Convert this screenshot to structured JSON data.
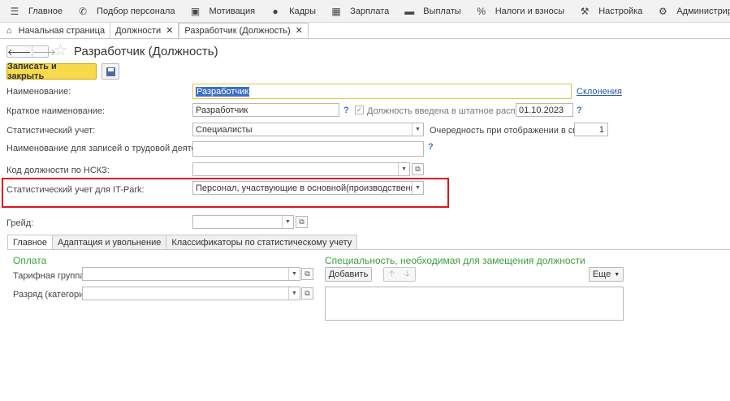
{
  "menu": [
    {
      "label": "Главное",
      "icon": "hamburger-icon"
    },
    {
      "label": "Подбор персонала",
      "icon": "phone-icon"
    },
    {
      "label": "Мотивация",
      "icon": "gift-icon"
    },
    {
      "label": "Кадры",
      "icon": "people-icon"
    },
    {
      "label": "Зарплата",
      "icon": "calculator-icon"
    },
    {
      "label": "Выплаты",
      "icon": "wallet-icon"
    },
    {
      "label": "Налоги и взносы",
      "icon": "percent-icon"
    },
    {
      "label": "Настройка",
      "icon": "wrench-icon"
    },
    {
      "label": "Администрирование",
      "icon": "gear-icon"
    }
  ],
  "tabs": [
    {
      "label": "Начальная страница"
    },
    {
      "label": "Должности"
    },
    {
      "label": "Разработчик (Должность)"
    }
  ],
  "form": {
    "title": "Разработчик (Должность)",
    "save_close_label": "Записать и закрыть"
  },
  "fields": {
    "name_label": "Наименование:",
    "name_value": "Разработчик",
    "declensions_link": "Склонения",
    "short_name_label": "Краткое наименование:",
    "short_name_value": "Разработчик",
    "in_staff_label": "Должность введена в штатное расписание",
    "in_staff_date": "01.10.2023",
    "stat_label": "Статистический учет:",
    "stat_value": "Специалисты",
    "order_label": "Очередность при отображении в списках:",
    "order_value": "1",
    "work_records_label": "Наименование для записей о трудовой деятельности:",
    "work_records_value": "",
    "nskz_label": "Код должности по НСКЗ:",
    "nskz_value": "",
    "itpark_label": "Статистический учет для IT-Park:",
    "itpark_value": "Персонал, участвующие в основной(производственной деятельности",
    "grade_label": "Грейд:",
    "grade_value": ""
  },
  "inner_tabs": [
    {
      "label": "Главное"
    },
    {
      "label": "Адаптация и увольнение"
    },
    {
      "label": "Классификаторы по статистическому учету"
    }
  ],
  "payment": {
    "title": "Оплата",
    "tariff_label": "Тарифная группа:",
    "tariff_value": "",
    "rank_label": "Разряд (категория):",
    "rank_value": ""
  },
  "specialty": {
    "title": "Специальность, необходимая для замещения должности",
    "add_label": "Добавить",
    "more_label": "Еще"
  },
  "help_mark": "?"
}
